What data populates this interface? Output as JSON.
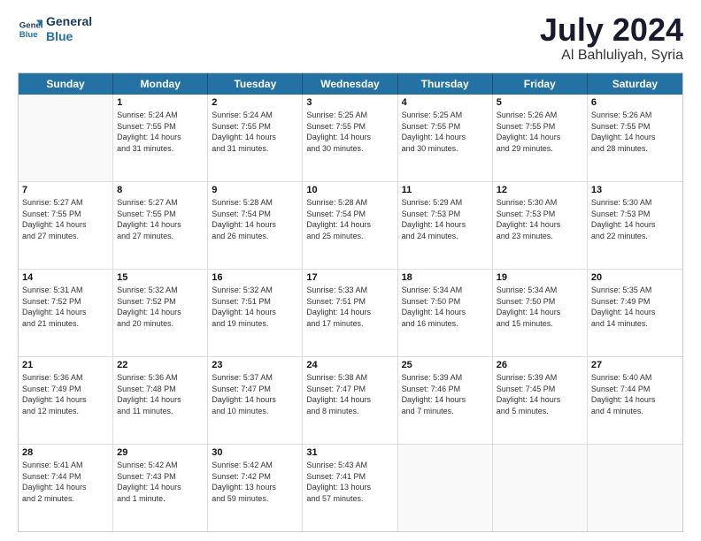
{
  "logo": {
    "line1": "General",
    "line2": "Blue"
  },
  "title": "July 2024",
  "location": "Al Bahluliyah, Syria",
  "days_of_week": [
    "Sunday",
    "Monday",
    "Tuesday",
    "Wednesday",
    "Thursday",
    "Friday",
    "Saturday"
  ],
  "weeks": [
    [
      {
        "day": "",
        "sunrise": "",
        "sunset": "",
        "daylight": ""
      },
      {
        "day": "1",
        "sunrise": "5:24 AM",
        "sunset": "7:55 PM",
        "daylight": "14 hours and 31 minutes."
      },
      {
        "day": "2",
        "sunrise": "5:24 AM",
        "sunset": "7:55 PM",
        "daylight": "14 hours and 31 minutes."
      },
      {
        "day": "3",
        "sunrise": "5:25 AM",
        "sunset": "7:55 PM",
        "daylight": "14 hours and 30 minutes."
      },
      {
        "day": "4",
        "sunrise": "5:25 AM",
        "sunset": "7:55 PM",
        "daylight": "14 hours and 30 minutes."
      },
      {
        "day": "5",
        "sunrise": "5:26 AM",
        "sunset": "7:55 PM",
        "daylight": "14 hours and 29 minutes."
      },
      {
        "day": "6",
        "sunrise": "5:26 AM",
        "sunset": "7:55 PM",
        "daylight": "14 hours and 28 minutes."
      }
    ],
    [
      {
        "day": "7",
        "sunrise": "5:27 AM",
        "sunset": "7:55 PM",
        "daylight": "14 hours and 27 minutes."
      },
      {
        "day": "8",
        "sunrise": "5:27 AM",
        "sunset": "7:55 PM",
        "daylight": "14 hours and 27 minutes."
      },
      {
        "day": "9",
        "sunrise": "5:28 AM",
        "sunset": "7:54 PM",
        "daylight": "14 hours and 26 minutes."
      },
      {
        "day": "10",
        "sunrise": "5:28 AM",
        "sunset": "7:54 PM",
        "daylight": "14 hours and 25 minutes."
      },
      {
        "day": "11",
        "sunrise": "5:29 AM",
        "sunset": "7:53 PM",
        "daylight": "14 hours and 24 minutes."
      },
      {
        "day": "12",
        "sunrise": "5:30 AM",
        "sunset": "7:53 PM",
        "daylight": "14 hours and 23 minutes."
      },
      {
        "day": "13",
        "sunrise": "5:30 AM",
        "sunset": "7:53 PM",
        "daylight": "14 hours and 22 minutes."
      }
    ],
    [
      {
        "day": "14",
        "sunrise": "5:31 AM",
        "sunset": "7:52 PM",
        "daylight": "14 hours and 21 minutes."
      },
      {
        "day": "15",
        "sunrise": "5:32 AM",
        "sunset": "7:52 PM",
        "daylight": "14 hours and 20 minutes."
      },
      {
        "day": "16",
        "sunrise": "5:32 AM",
        "sunset": "7:51 PM",
        "daylight": "14 hours and 19 minutes."
      },
      {
        "day": "17",
        "sunrise": "5:33 AM",
        "sunset": "7:51 PM",
        "daylight": "14 hours and 17 minutes."
      },
      {
        "day": "18",
        "sunrise": "5:34 AM",
        "sunset": "7:50 PM",
        "daylight": "14 hours and 16 minutes."
      },
      {
        "day": "19",
        "sunrise": "5:34 AM",
        "sunset": "7:50 PM",
        "daylight": "14 hours and 15 minutes."
      },
      {
        "day": "20",
        "sunrise": "5:35 AM",
        "sunset": "7:49 PM",
        "daylight": "14 hours and 14 minutes."
      }
    ],
    [
      {
        "day": "21",
        "sunrise": "5:36 AM",
        "sunset": "7:49 PM",
        "daylight": "14 hours and 12 minutes."
      },
      {
        "day": "22",
        "sunrise": "5:36 AM",
        "sunset": "7:48 PM",
        "daylight": "14 hours and 11 minutes."
      },
      {
        "day": "23",
        "sunrise": "5:37 AM",
        "sunset": "7:47 PM",
        "daylight": "14 hours and 10 minutes."
      },
      {
        "day": "24",
        "sunrise": "5:38 AM",
        "sunset": "7:47 PM",
        "daylight": "14 hours and 8 minutes."
      },
      {
        "day": "25",
        "sunrise": "5:39 AM",
        "sunset": "7:46 PM",
        "daylight": "14 hours and 7 minutes."
      },
      {
        "day": "26",
        "sunrise": "5:39 AM",
        "sunset": "7:45 PM",
        "daylight": "14 hours and 5 minutes."
      },
      {
        "day": "27",
        "sunrise": "5:40 AM",
        "sunset": "7:44 PM",
        "daylight": "14 hours and 4 minutes."
      }
    ],
    [
      {
        "day": "28",
        "sunrise": "5:41 AM",
        "sunset": "7:44 PM",
        "daylight": "14 hours and 2 minutes."
      },
      {
        "day": "29",
        "sunrise": "5:42 AM",
        "sunset": "7:43 PM",
        "daylight": "14 hours and 1 minute."
      },
      {
        "day": "30",
        "sunrise": "5:42 AM",
        "sunset": "7:42 PM",
        "daylight": "13 hours and 59 minutes."
      },
      {
        "day": "31",
        "sunrise": "5:43 AM",
        "sunset": "7:41 PM",
        "daylight": "13 hours and 57 minutes."
      },
      {
        "day": "",
        "sunrise": "",
        "sunset": "",
        "daylight": ""
      },
      {
        "day": "",
        "sunrise": "",
        "sunset": "",
        "daylight": ""
      },
      {
        "day": "",
        "sunrise": "",
        "sunset": "",
        "daylight": ""
      }
    ]
  ]
}
